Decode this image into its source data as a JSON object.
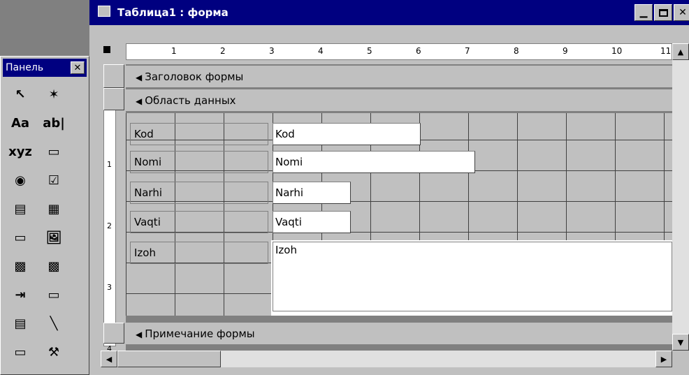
{
  "window": {
    "title": "Таблица1 : форма",
    "title_bar_color": "#000080",
    "design_grid_color": "#c0c0c0",
    "detail_area_color": "#ffffff"
  },
  "toolbox": {
    "title": "Панель",
    "tools": [
      {
        "name": "select-objects-icon",
        "glyph": "↖"
      },
      {
        "name": "control-wizards-icon",
        "glyph": "✶"
      },
      {
        "name": "label-tool-icon",
        "glyph": "Aa"
      },
      {
        "name": "text-box-tool-icon",
        "glyph": "ab|"
      },
      {
        "name": "option-group-icon",
        "glyph": "xyz"
      },
      {
        "name": "toggle-button-icon",
        "glyph": "▭"
      },
      {
        "name": "option-button-icon",
        "glyph": "◉"
      },
      {
        "name": "check-box-icon",
        "glyph": "☑"
      },
      {
        "name": "combo-box-icon",
        "glyph": "▤"
      },
      {
        "name": "list-box-icon",
        "glyph": "▦"
      },
      {
        "name": "command-button-icon",
        "glyph": "▭"
      },
      {
        "name": "image-tool-icon",
        "glyph": "🖼"
      },
      {
        "name": "unbound-object-frame-icon",
        "glyph": "▩"
      },
      {
        "name": "bound-object-frame-icon",
        "glyph": "▩"
      },
      {
        "name": "page-break-icon",
        "glyph": "⇥"
      },
      {
        "name": "tab-control-icon",
        "glyph": "▭"
      },
      {
        "name": "subform-icon",
        "glyph": "▤"
      },
      {
        "name": "line-tool-icon",
        "glyph": "╲"
      },
      {
        "name": "rectangle-tool-icon",
        "glyph": "▭"
      },
      {
        "name": "more-controls-icon",
        "glyph": "⚒"
      }
    ]
  },
  "ruler": {
    "marks": [
      "1",
      "2",
      "3",
      "4",
      "5",
      "6",
      "7",
      "8",
      "9",
      "10",
      "11"
    ]
  },
  "vertical_ruler": {
    "marks": [
      "1",
      "2",
      "3",
      "4"
    ]
  },
  "sections": {
    "header": "Заголовок формы",
    "detail": "Область данных",
    "footer": "Примечание формы"
  },
  "fields": [
    {
      "label": "Kod",
      "textbox": "Kod"
    },
    {
      "label": "Nomi",
      "textbox": "Nomi"
    },
    {
      "label": "Narhi",
      "textbox": "Narhi"
    },
    {
      "label": "Vaqti",
      "textbox": "Vaqti"
    },
    {
      "label": "Izoh",
      "textbox": "Izoh"
    }
  ]
}
